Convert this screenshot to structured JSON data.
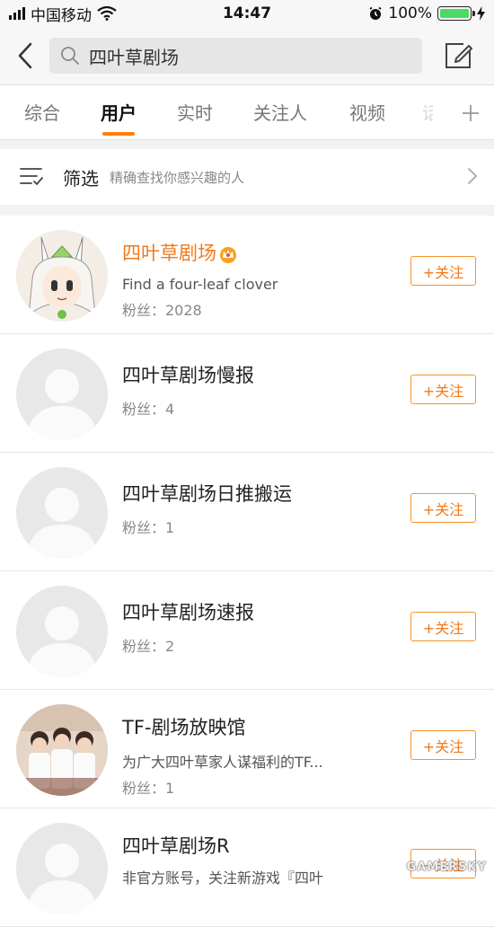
{
  "status_bar": {
    "carrier": "中国移动",
    "time": "14:47",
    "battery": "100%"
  },
  "search": {
    "query": "四叶草剧场"
  },
  "tabs": [
    {
      "label": "综合",
      "active": false
    },
    {
      "label": "用户",
      "active": true
    },
    {
      "label": "实时",
      "active": false
    },
    {
      "label": "关注人",
      "active": false
    },
    {
      "label": "视频",
      "active": false
    }
  ],
  "filter": {
    "title": "筛选",
    "description": "精确查找你感兴趣的人"
  },
  "follow_label": "+关注",
  "users": [
    {
      "name": "四叶草剧场",
      "verified_crown": true,
      "description": "Find a four-leaf clover",
      "fans": "粉丝：2028",
      "avatar": "anime-character"
    },
    {
      "name": "四叶草剧场慢报",
      "description": "",
      "fans": "粉丝：4",
      "avatar": "default"
    },
    {
      "name": "四叶草剧场日推搬运",
      "description": "",
      "fans": "粉丝：1",
      "avatar": "default"
    },
    {
      "name": "四叶草剧场速报",
      "description": "",
      "fans": "粉丝：2",
      "avatar": "default"
    },
    {
      "name": "TF-剧场放映馆",
      "description": "为广大四叶草家人谋福利的TF...",
      "fans": "粉丝：1",
      "avatar": "group-photo"
    },
    {
      "name": "四叶草剧场R",
      "description": "非官方账号，关注新游戏『四叶",
      "fans": "",
      "avatar": "default"
    }
  ],
  "watermark": "GAMERSKY",
  "colors": {
    "accent": "#ff8200",
    "follow_border": "#f7922b",
    "verified_name": "#f07a1c",
    "battery": "#4cd964"
  }
}
